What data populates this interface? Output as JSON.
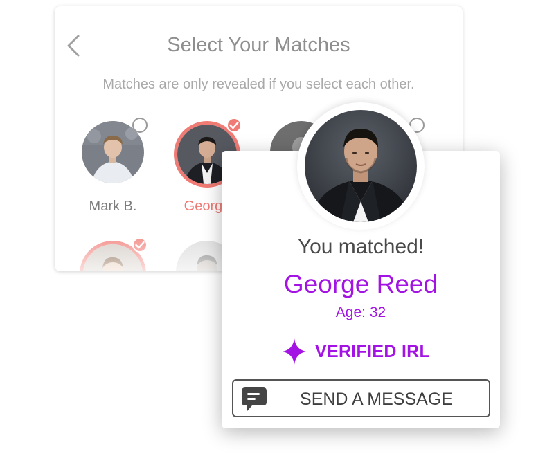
{
  "select_screen": {
    "title": "Select Your Matches",
    "subtitle": "Matches are only revealed if you select each other.",
    "back_icon": "chevron-left-icon",
    "matches": [
      {
        "name": "Mark B.",
        "selected": false
      },
      {
        "name": "George",
        "selected": true
      }
    ]
  },
  "match_popup": {
    "headline": "You matched!",
    "name": "George Reed",
    "age": "Age: 32",
    "verified_label": "VERIFIED IRL",
    "verified_icon": "sparkle-icon",
    "send_button": {
      "label": "SEND A MESSAGE",
      "icon": "chat-bubble-icon"
    }
  },
  "colors": {
    "accent_purple": "#a313e3",
    "selected_coral": "#f07a74",
    "text_gray": "#8e8e8e"
  }
}
